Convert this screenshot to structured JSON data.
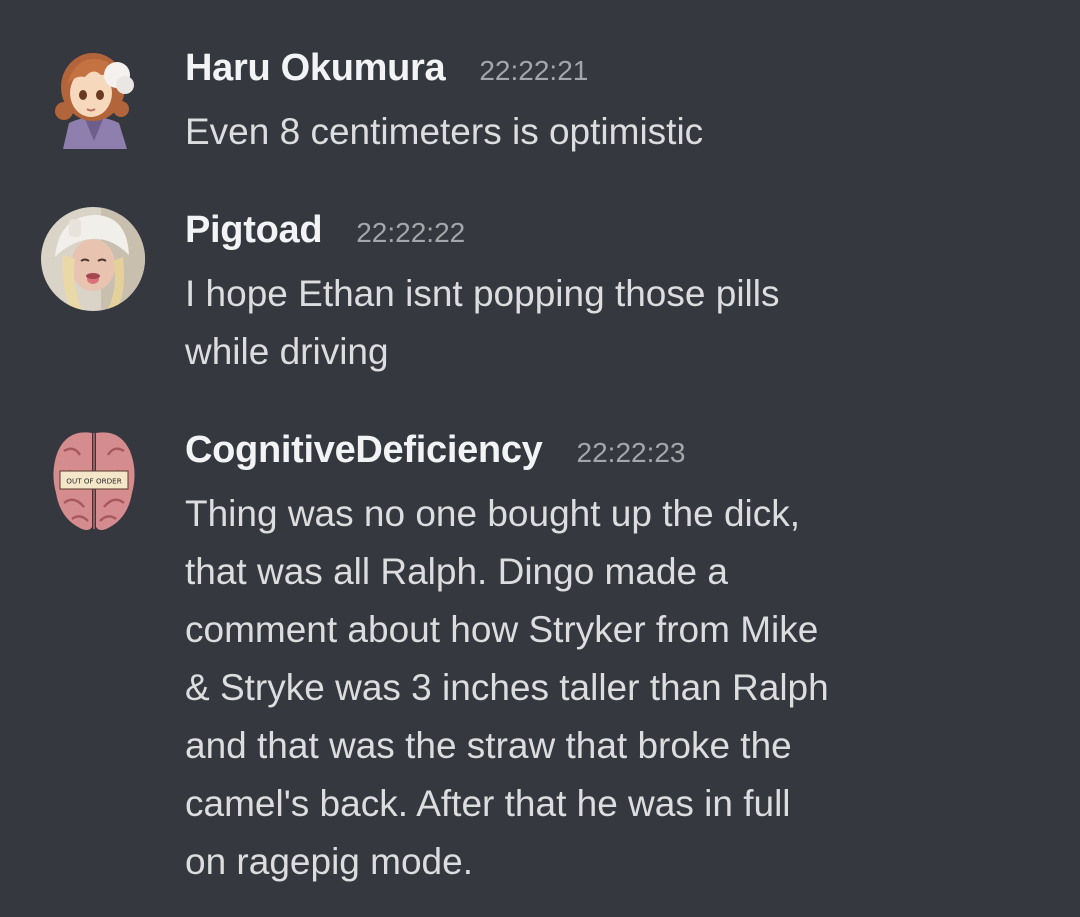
{
  "messages": [
    {
      "username": "Haru Okumura",
      "timestamp": "22:22:21",
      "text": "Even 8 centimeters is optimistic",
      "avatar_icon": "anime-girl-avatar-icon"
    },
    {
      "username": "Pigtoad",
      "timestamp": "22:22:22",
      "text": "I hope Ethan isnt popping those pills\nwhile driving",
      "avatar_icon": "photo-avatar-icon"
    },
    {
      "username": "CognitiveDeficiency",
      "timestamp": "22:22:23",
      "text": "Thing was no one bought up the dick,\nthat was all Ralph. Dingo made a\ncomment about how Stryker from Mike\n& Stryke was 3 inches taller than Ralph\nand that was the straw that broke the\ncamel's back. After that he was in full\non ragepig mode.",
      "avatar_icon": "brain-avatar-icon",
      "avatar_sign_text": "OUT OF ORDER"
    }
  ],
  "colors": {
    "background": "#36383f",
    "username": "#f2f3f5",
    "timestamp": "#a3a6aa",
    "message_text": "#dcddde"
  }
}
